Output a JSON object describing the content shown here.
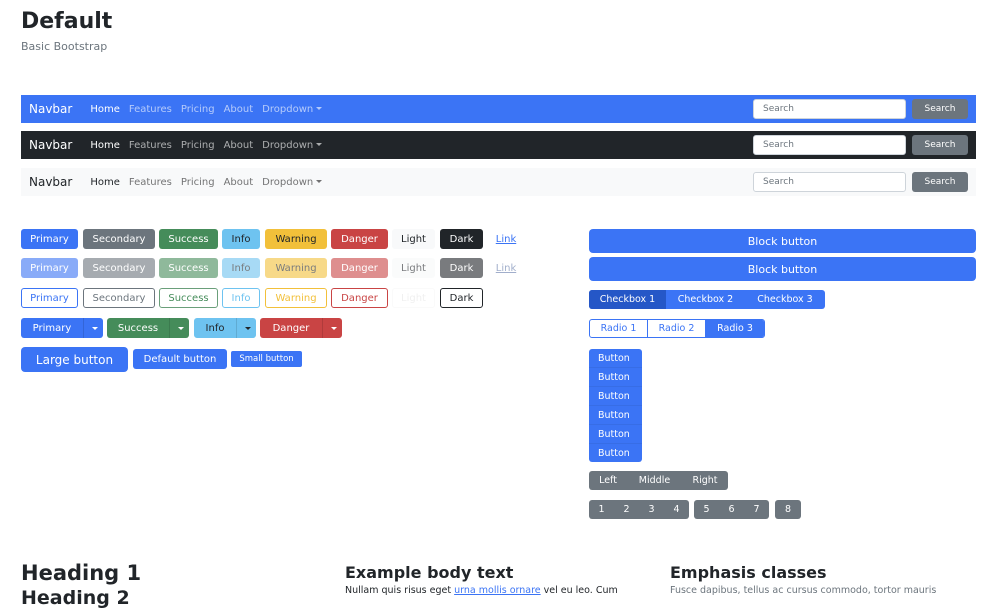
{
  "header": {
    "title": "Default",
    "subtitle": "Basic Bootstrap"
  },
  "navbars": {
    "brand": "Navbar",
    "links": [
      "Home",
      "Features",
      "Pricing",
      "About",
      "Dropdown"
    ],
    "search_placeholder": "Search",
    "search_button": "Search"
  },
  "buttons": {
    "labels": [
      "Primary",
      "Secondary",
      "Success",
      "Info",
      "Warning",
      "Danger",
      "Light",
      "Dark",
      "Link"
    ],
    "split_labels": [
      "Primary",
      "Success",
      "Info",
      "Danger"
    ],
    "sizes": [
      "Large button",
      "Default button",
      "Small button"
    ]
  },
  "right": {
    "block": [
      "Block button",
      "Block button"
    ],
    "checkboxes": [
      "Checkbox 1",
      "Checkbox 2",
      "Checkbox 3"
    ],
    "radios": [
      "Radio 1",
      "Radio 2",
      "Radio 3"
    ],
    "vertical": [
      "Button",
      "Button",
      "Button",
      "Button",
      "Button",
      "Button"
    ],
    "lmr": [
      "Left",
      "Middle",
      "Right"
    ],
    "pages_a": [
      "1",
      "2",
      "3",
      "4"
    ],
    "pages_b": [
      "5",
      "6",
      "7"
    ],
    "pages_c": [
      "8"
    ]
  },
  "bottom": {
    "h1": "Heading 1",
    "h2": "Heading 2",
    "body_title": "Example body text",
    "body_pre": "Nullam quis risus eget ",
    "body_link": "urna mollis ornare",
    "body_post": " vel eu leo. Cum",
    "emph_title": "Emphasis classes",
    "emph_text": "Fusce dapibus, tellus ac cursus commodo, tortor mauris"
  }
}
